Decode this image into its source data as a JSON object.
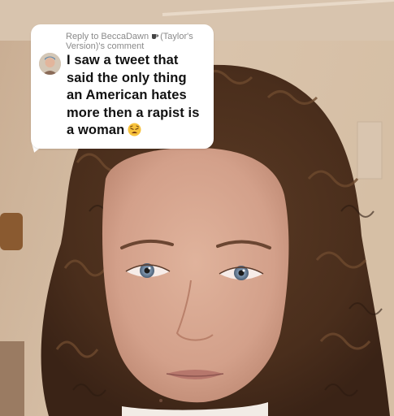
{
  "reply": {
    "header_prefix": "Reply to BeccaDawn",
    "header_suffix": "(Taylor's Version)'s comment",
    "comment": "I saw a tweet that said the only thing an American hates more then a rapist is a woman",
    "emoji_icon": "weary-face-emoji-icon",
    "separator_icon": "coffee-cup-icon"
  },
  "colors": {
    "bubble_background": "#ffffff",
    "header_text": "#8a8a8a",
    "comment_text": "#111111"
  }
}
